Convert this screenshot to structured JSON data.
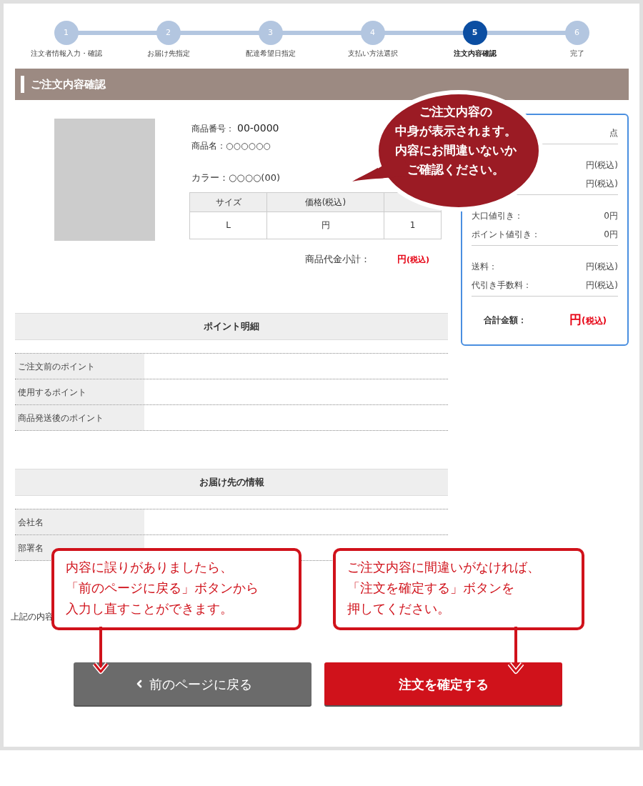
{
  "steps": [
    {
      "number": "1",
      "label": "注文者情報入力・確認",
      "selected": false
    },
    {
      "number": "2",
      "label": "お届け先指定",
      "selected": false
    },
    {
      "number": "3",
      "label": "配達希望日指定",
      "selected": false
    },
    {
      "number": "4",
      "label": "支払い方法選択",
      "selected": false
    },
    {
      "number": "5",
      "label": "注文内容確認",
      "selected": true
    },
    {
      "number": "6",
      "label": "完了",
      "selected": false
    }
  ],
  "section_title": "ご注文内容確認",
  "product": {
    "number_label": "商品番号：",
    "number": "00-0000",
    "name_label": "商品名：",
    "name": "○○○○○○",
    "color_label": "カラー：",
    "color_name": "○○○○(00)",
    "table": {
      "columns": [
        "サイズ",
        "価格(税込)"
      ],
      "rows": [
        [
          "L",
          "円",
          "1"
        ]
      ]
    },
    "subtotal_label": "商品代金小計：",
    "subtotal_value": "円",
    "subtotal_tax": "(税込)"
  },
  "summary": {
    "groups": [
      [
        {
          "value": "点"
        }
      ],
      [
        {
          "value": "円(税込)"
        },
        {
          "value": "円(税込)"
        }
      ],
      [
        {
          "label": "大口値引き：",
          "value": "0円"
        },
        {
          "label": "ポイント値引き：",
          "value": "0円"
        }
      ],
      [
        {
          "label": "送料：",
          "value": "円(税込)"
        },
        {
          "label": "代引き手数料：",
          "value": "円(税込)"
        }
      ]
    ],
    "total_label": "合計金額：",
    "total_value": "円",
    "total_tax": "(税込)"
  },
  "points": {
    "title": "ポイント明細",
    "rows": [
      "ご注文前のポイント",
      "使用するポイント",
      "商品発送後のポイント"
    ]
  },
  "delivery": {
    "title": "お届け先の情報",
    "rows": [
      "会社名",
      "部署名"
    ]
  },
  "note": "上記の内容",
  "buttons": [
    {
      "kind": "back",
      "label": "前のページに戻る"
    },
    {
      "kind": "confirm",
      "label": "注文を確定する"
    }
  ],
  "bubble": [
    "ご注文内容の",
    "中身が表示されます。",
    "内容にお間違いないか",
    "ご確認ください。"
  ],
  "callouts": [
    [
      "内容に誤りがありましたら、",
      "「前のページに戻る」ボタンから",
      "入力し直すことができます。"
    ],
    [
      "ご注文内容に間違いがなければ、",
      "「注文を確定する」ボタンを",
      "押してください。"
    ]
  ]
}
